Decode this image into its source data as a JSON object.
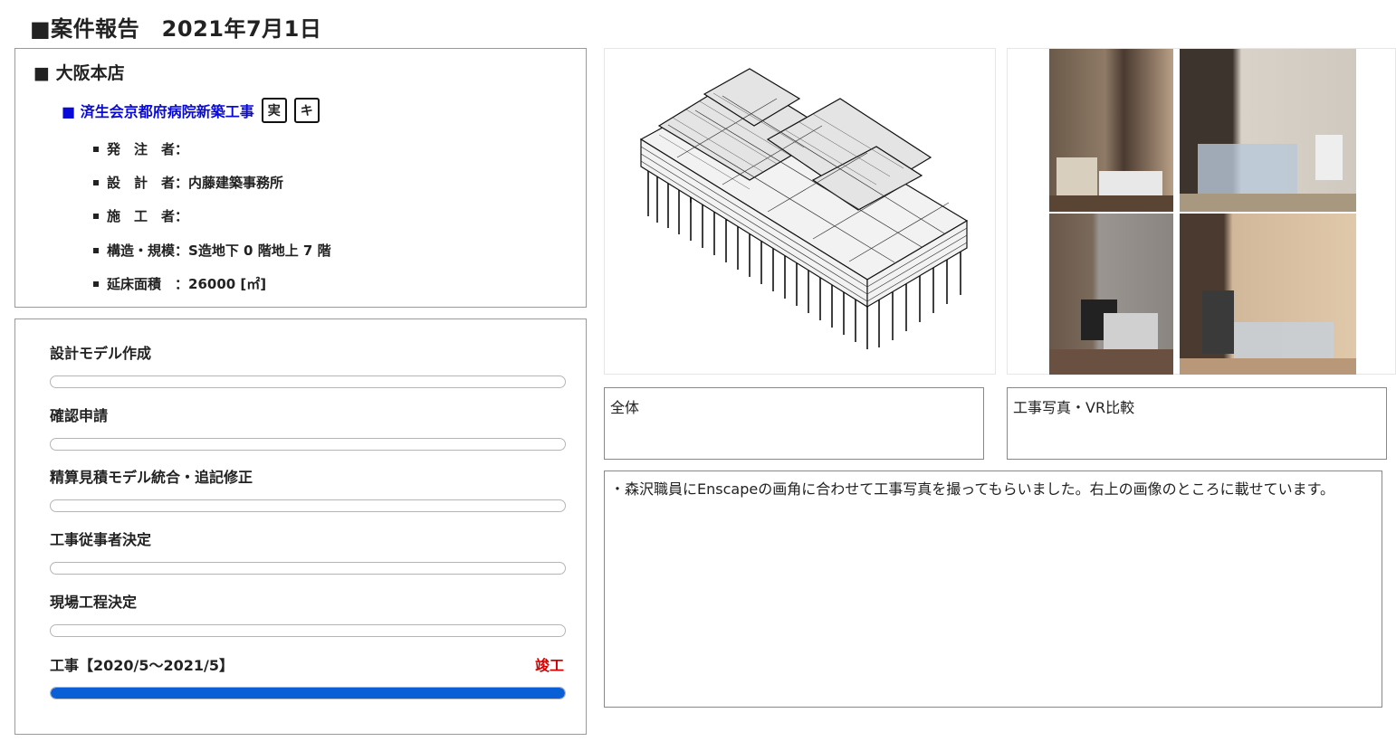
{
  "page_title": "■案件報告　2021年7月1日",
  "office": {
    "name": "■ 大阪本店",
    "project": {
      "name": "■ 済生会京都府病院新築工事",
      "badges": [
        "実",
        "キ"
      ]
    },
    "details": [
      {
        "label": "発　注　者：",
        "value": ""
      },
      {
        "label": "設　計　者：",
        "value": "内藤建築事務所"
      },
      {
        "label": "施　工　者：",
        "value": ""
      },
      {
        "label": "構造・規模：",
        "value": "S造地下 0 階地上 7 階"
      },
      {
        "label": "延床面積　：",
        "value": "26000 [㎡]"
      }
    ]
  },
  "progress": {
    "steps": [
      {
        "label": "設計モデル作成",
        "progress": 0
      },
      {
        "label": "確認申請",
        "progress": 0
      },
      {
        "label": "精算見積モデル統合・追記修正",
        "progress": 0
      },
      {
        "label": "工事従事者決定",
        "progress": 0
      },
      {
        "label": "現場工程決定",
        "progress": 0
      },
      {
        "label": "工事【2020/5～2021/5】",
        "progress": 1.0
      }
    ],
    "status": "竣工",
    "bar_color": "#0a5fd6",
    "status_color": "#d40000"
  },
  "captions": {
    "model": "全体",
    "photos": "工事写真・VR比較"
  },
  "comment": "・森沢職員にEnscapeの画角に合わせて工事写真を撮ってもらいました。右上の画像のところに載せています。",
  "colors": {
    "project_link": "#0a0ad8"
  }
}
